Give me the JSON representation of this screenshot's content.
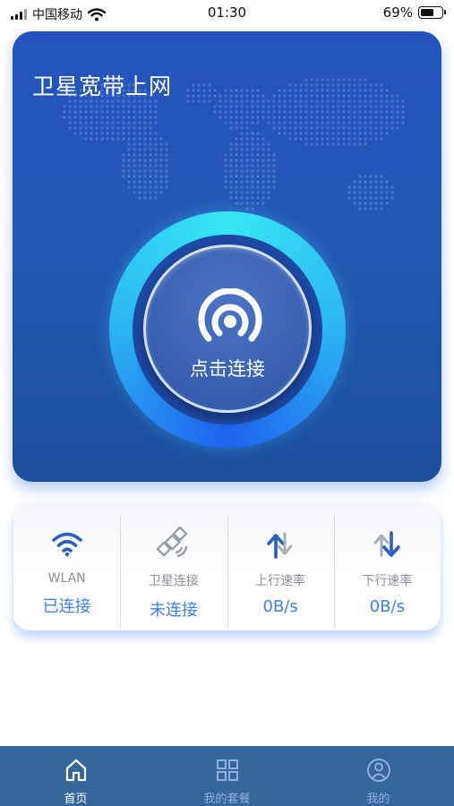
{
  "status_bar": {
    "carrier": "中国移动",
    "time": "01:30",
    "battery_percent_text": "69%",
    "battery_level": 0.69
  },
  "hero": {
    "title": "卫星宽带上网",
    "connect_label": "点击连接",
    "connect_icon": "signal-broadcast-icon"
  },
  "stats": [
    {
      "icon": "wifi-icon",
      "label": "WLAN",
      "value": "已连接"
    },
    {
      "icon": "satellite-icon",
      "label": "卫星连接",
      "value": "未连接"
    },
    {
      "icon": "upload-arrows-icon",
      "label": "上行速率",
      "value": "0B/s"
    },
    {
      "icon": "download-arrows-icon",
      "label": "下行速率",
      "value": "0B/s"
    }
  ],
  "tabbar": {
    "tabs": [
      {
        "icon": "home-icon",
        "label": "首页",
        "active": true
      },
      {
        "icon": "grid-icon",
        "label": "我的套餐",
        "active": false
      },
      {
        "icon": "user-icon",
        "label": "我的",
        "active": false
      }
    ]
  },
  "colors": {
    "accent": "#3f82ea",
    "hero_blue": "#2453bf",
    "tabbar_bg": "#35669c",
    "ring_cyan": "#37e6f5"
  }
}
